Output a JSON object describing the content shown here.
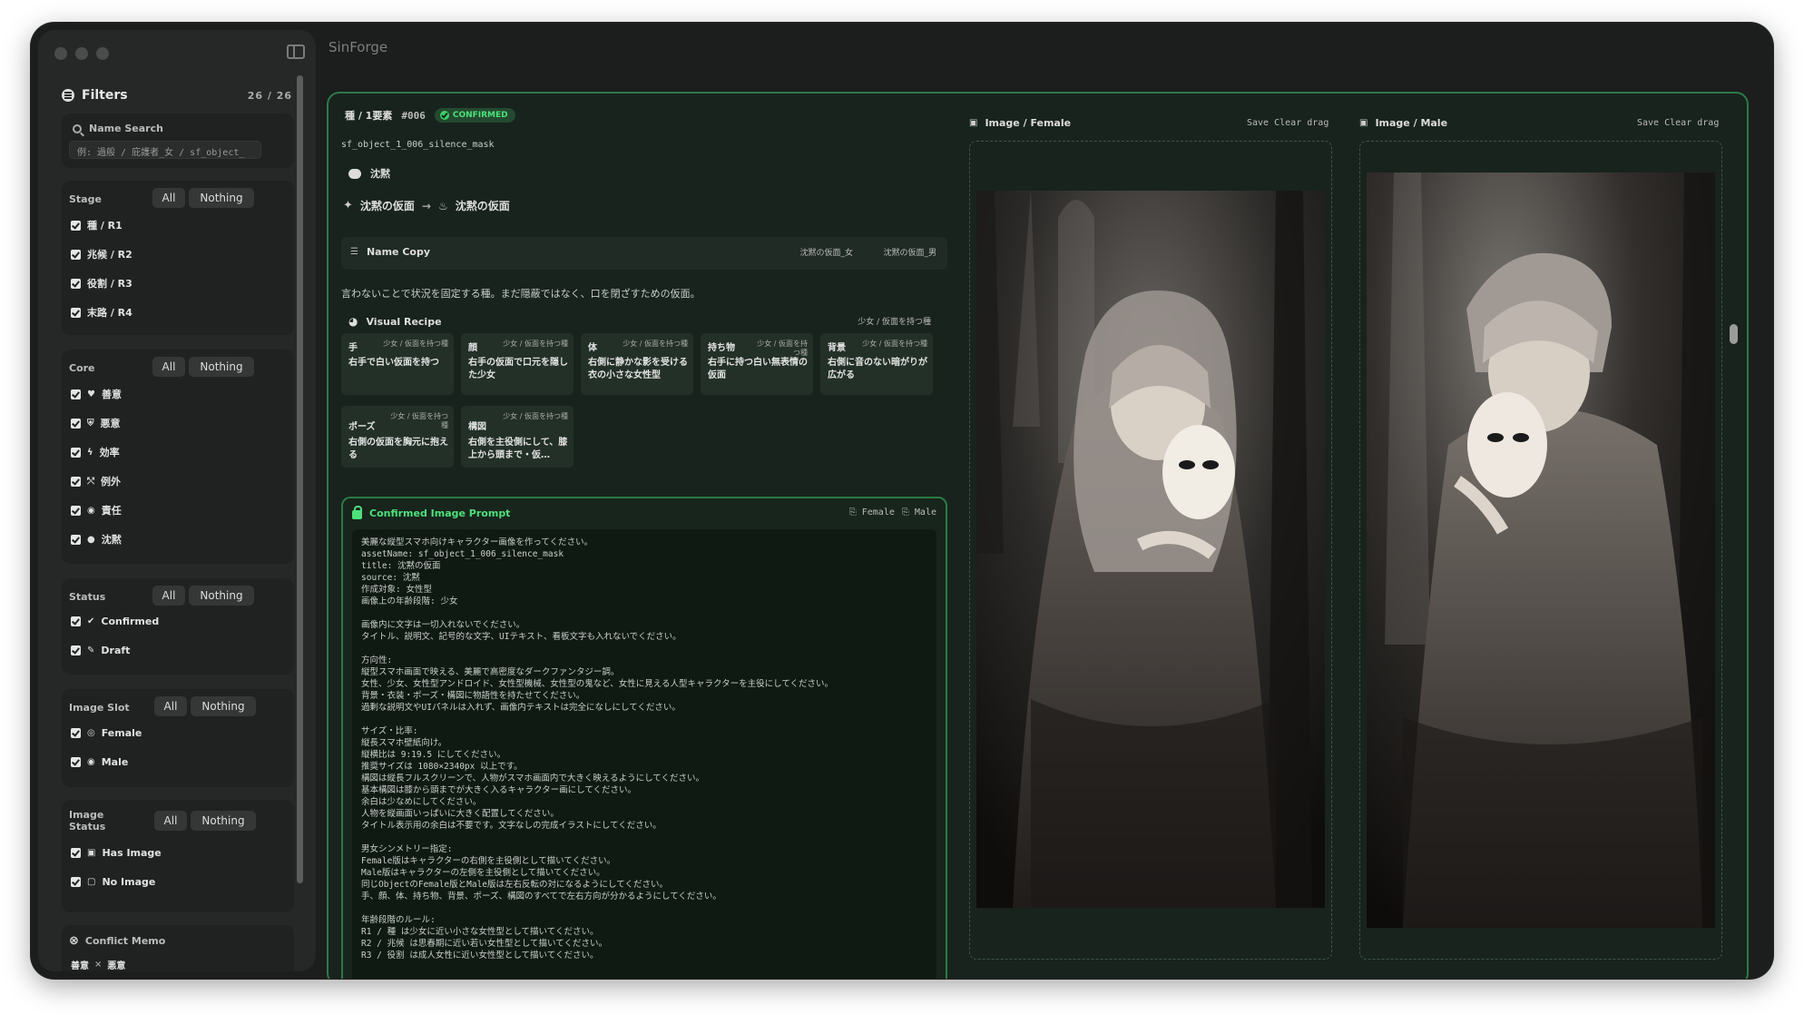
{
  "app": {
    "title": "SinForge"
  },
  "filters": {
    "title": "Filters",
    "count": "26 / 26",
    "name_search": {
      "label": "Name Search",
      "placeholder": "例: 過般 / 庇護者_女 / sf_object_"
    },
    "groups": [
      {
        "title": "Stage",
        "all": "All",
        "nothing": "Nothing",
        "options": [
          "種 / R1",
          "兆候 / R2",
          "役割 / R3",
          "末路 / R4"
        ],
        "icons": [
          "",
          "",
          "",
          ""
        ]
      },
      {
        "title": "Core",
        "all": "All",
        "nothing": "Nothing",
        "options": [
          "善意",
          "悪意",
          "効率",
          "例外",
          "責任",
          "沈黙"
        ],
        "icons": [
          "heart-icon",
          "shield-icon",
          "bolt-icon",
          "branch-icon",
          "person-icon",
          "bubble-icon"
        ]
      },
      {
        "title": "Status",
        "all": "All",
        "nothing": "Nothing",
        "options": [
          "Confirmed",
          "Draft"
        ],
        "icons": [
          "check-circle-icon",
          "pencil-icon"
        ]
      },
      {
        "title": "Image Slot",
        "all": "All",
        "nothing": "Nothing",
        "options": [
          "Female",
          "Male"
        ],
        "icons": [
          "female-icon",
          "male-icon"
        ]
      },
      {
        "title": "Image Status",
        "all": "All",
        "nothing": "Nothing",
        "options": [
          "Has Image",
          "No Image"
        ],
        "icons": [
          "image-icon",
          "no-image-icon"
        ]
      }
    ],
    "conflict_memo": {
      "title": "Conflict Memo",
      "left": "善意",
      "sep": "×",
      "right": "悪意"
    }
  },
  "detail": {
    "stage": "種 / 1要素",
    "number": "#006",
    "status": "CONFIRMED",
    "asset_name": "sf_object_1_006_silence_mask",
    "source": "沈黙",
    "from": "沈黙の仮面",
    "arrow": "→",
    "to": "沈黙の仮面",
    "name_copy": {
      "label": "Name Copy",
      "female": "沈黙の仮面_女",
      "male": "沈黙の仮面_男"
    },
    "description": "言わないことで状況を固定する種。まだ隠蔽ではなく、口を閉ざすための仮面。",
    "visual_recipe": {
      "label": "Visual Recipe",
      "context": "少女 / 仮面を持つ種",
      "items": [
        {
          "key": "手",
          "tag": "少女 / 仮面を持つ種",
          "value": "右手で白い仮面を持つ"
        },
        {
          "key": "顔",
          "tag": "少女 / 仮面を持つ種",
          "value": "右手の仮面で口元を隠した少女"
        },
        {
          "key": "体",
          "tag": "少女 / 仮面を持つ種",
          "value": "右側に静かな影を受ける衣の小さな女性型"
        },
        {
          "key": "持ち物",
          "tag": "少女 / 仮面を持つ種",
          "value": "右手に持つ白い無表情の仮面"
        },
        {
          "key": "背景",
          "tag": "少女 / 仮面を持つ種",
          "value": "右側に音のない暗がりが広がる"
        },
        {
          "key": "ポーズ",
          "tag": "少女 / 仮面を持つ種",
          "value": "右側の仮面を胸元に抱える"
        },
        {
          "key": "構図",
          "tag": "少女 / 仮面を持つ種",
          "value": "右側を主役側にして、膝上から頭まで・仮…"
        }
      ]
    },
    "prompt": {
      "label": "Confirmed Image Prompt",
      "copy_female": "Female",
      "copy_male": "Male",
      "lines": [
        "美麗な縦型スマホ向けキャラクター画像を作ってください。",
        "assetName: sf_object_1_006_silence_mask",
        "title: 沈黙の仮面",
        "source: 沈黙",
        "作成対象: 女性型",
        "画像上の年齢段階: 少女",
        "",
        "画像内に文字は一切入れないでください。",
        "タイトル、説明文、記号的な文字、UIテキスト、看板文字も入れないでください。",
        "",
        "方向性:",
        "縦型スマホ画面で映える、美麗で高密度なダークファンタジー調。",
        "女性、少女、女性型アンドロイド、女性型機械、女性型の鬼など、女性に見える人型キャラクターを主役にしてください。",
        "背景・衣装・ポーズ・構図に物語性を持たせてください。",
        "過剰な説明文やUIパネルは入れず、画像内テキストは完全になしにしてください。",
        "",
        "サイズ・比率:",
        "縦長スマホ壁紙向け。",
        "縦横比は 9:19.5 にしてください。",
        "推奨サイズは 1080×2340px 以上です。",
        "構図は縦長フルスクリーンで、人物がスマホ画面内で大きく映えるようにしてください。",
        "基本構図は膝から頭までが大きく入るキャラクター画にしてください。",
        "余白は少なめにしてください。",
        "人物を縦画面いっぱいに大きく配置してください。",
        "タイトル表示用の余白は不要です。文字なしの完成イラストにしてください。",
        "",
        "男女シンメトリー指定:",
        "Female版はキャラクターの右側を主役側として描いてください。",
        "Male版はキャラクターの左側を主役側として描いてください。",
        "同じObjectのFemale版とMale版は左右反転の対になるようにしてください。",
        "手、顔、体、持ち物、背景、ポーズ、構図のすべてで左右方向が分かるようにしてください。",
        "",
        "年齢段階のルール:",
        "R1 / 種 は少女に近い小さな女性型として描いてください。",
        "R2 / 兆候 は思春期に近い若い女性型として描いてください。",
        "R3 / 役割 は成人女性に近い女性型として描いてください。"
      ]
    }
  },
  "image_female": {
    "label": "Image / Female",
    "save": "Save",
    "clear": "Clear",
    "drag": "drag"
  },
  "image_male": {
    "label": "Image / Male",
    "save": "Save",
    "clear": "Clear",
    "drag": "drag"
  },
  "colors": {
    "accent": "#2d7a48",
    "confirmed": "#4ee07a",
    "panel": "#18231d",
    "sidebar": "#262727"
  }
}
